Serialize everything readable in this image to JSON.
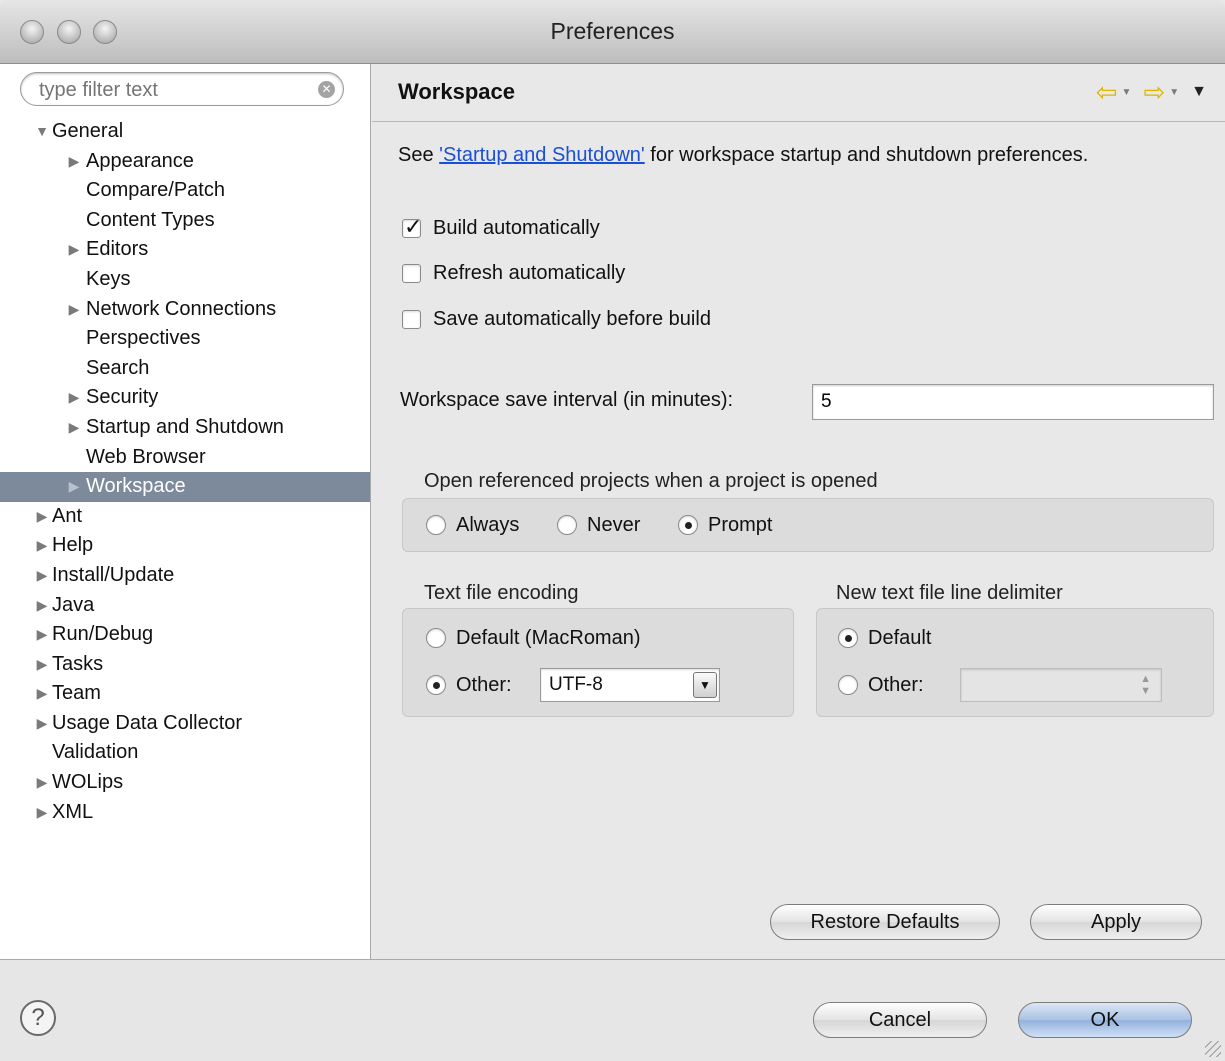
{
  "window": {
    "title": "Preferences"
  },
  "filter": {
    "placeholder": "type filter text"
  },
  "tree": [
    {
      "label": "General",
      "level": 0,
      "expanded": true
    },
    {
      "label": "Appearance",
      "level": 1,
      "expander": true
    },
    {
      "label": "Compare/Patch",
      "level": 1,
      "expander": false
    },
    {
      "label": "Content Types",
      "level": 1,
      "expander": false
    },
    {
      "label": "Editors",
      "level": 1,
      "expander": true
    },
    {
      "label": "Keys",
      "level": 1,
      "expander": false
    },
    {
      "label": "Network Connections",
      "level": 1,
      "expander": true
    },
    {
      "label": "Perspectives",
      "level": 1,
      "expander": false
    },
    {
      "label": "Search",
      "level": 1,
      "expander": false
    },
    {
      "label": "Security",
      "level": 1,
      "expander": true
    },
    {
      "label": "Startup and Shutdown",
      "level": 1,
      "expander": true
    },
    {
      "label": "Web Browser",
      "level": 1,
      "expander": false
    },
    {
      "label": "Workspace",
      "level": 1,
      "expander": true,
      "selected": true
    },
    {
      "label": "Ant",
      "level": 0,
      "expander": true
    },
    {
      "label": "Help",
      "level": 0,
      "expander": true
    },
    {
      "label": "Install/Update",
      "level": 0,
      "expander": true
    },
    {
      "label": "Java",
      "level": 0,
      "expander": true
    },
    {
      "label": "Run/Debug",
      "level": 0,
      "expander": true
    },
    {
      "label": "Tasks",
      "level": 0,
      "expander": true
    },
    {
      "label": "Team",
      "level": 0,
      "expander": true
    },
    {
      "label": "Usage Data Collector",
      "level": 0,
      "expander": true
    },
    {
      "label": "Validation",
      "level": 0,
      "expander": false
    },
    {
      "label": "WOLips",
      "level": 0,
      "expander": true
    },
    {
      "label": "XML",
      "level": 0,
      "expander": true
    }
  ],
  "page": {
    "title": "Workspace",
    "see_prefix": "See ",
    "see_link": "'Startup and Shutdown'",
    "see_suffix": " for workspace startup and shutdown preferences.",
    "build_auto": {
      "label": "Build automatically",
      "checked": true
    },
    "refresh_auto": {
      "label": "Refresh automatically",
      "checked": false
    },
    "save_auto": {
      "label": "Save automatically before build",
      "checked": false
    },
    "interval_label": "Workspace save interval (in minutes):",
    "interval_value": "5",
    "open_ref": {
      "label": "Open referenced projects when a project is opened",
      "always": "Always",
      "never": "Never",
      "prompt": "Prompt",
      "selected": "Prompt"
    },
    "encoding": {
      "label": "Text file encoding",
      "default": "Default (MacRoman)",
      "other": "Other:",
      "value": "UTF-8",
      "selected": "Other"
    },
    "delimiter": {
      "label": "New text file line delimiter",
      "default": "Default",
      "other": "Other:",
      "selected": "Default"
    },
    "restore_defaults": "Restore Defaults",
    "apply": "Apply"
  },
  "footer": {
    "help": "?",
    "cancel": "Cancel",
    "ok": "OK"
  },
  "colors": {
    "selection": "#7d8a9b",
    "link": "#1a4fd6",
    "nav_arrow": "#e0b400"
  }
}
